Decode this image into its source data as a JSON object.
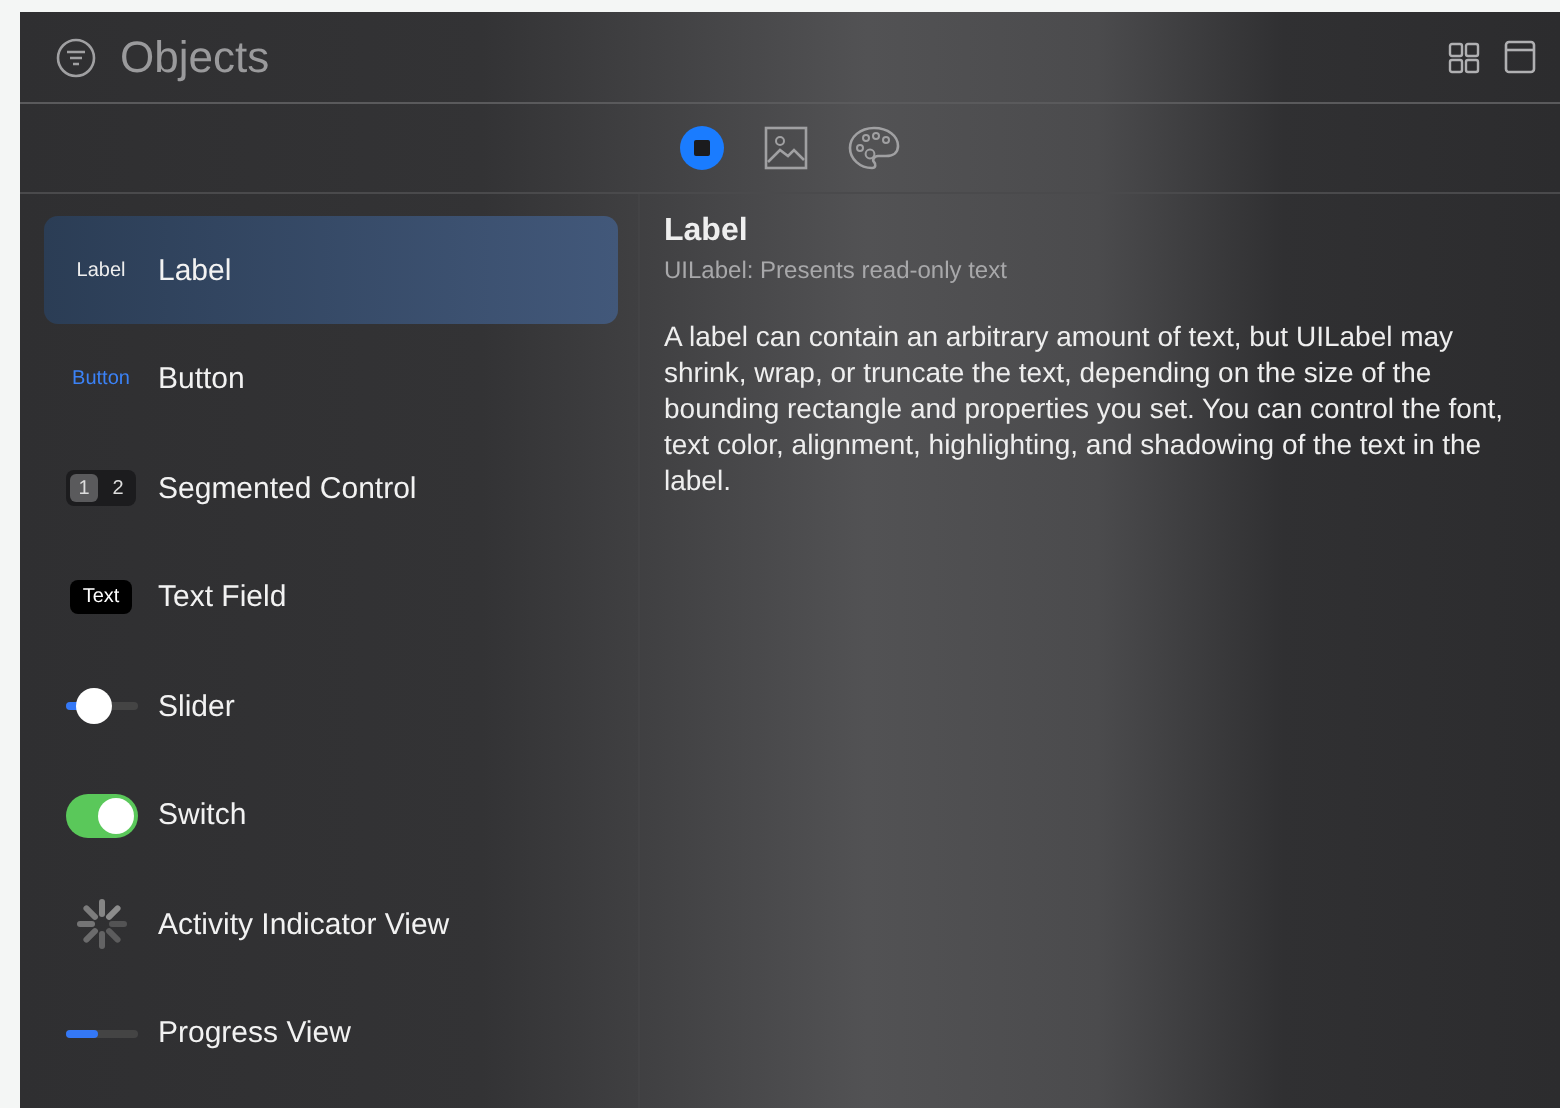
{
  "header": {
    "title": "Objects"
  },
  "tabs": [
    {
      "kind": "objects",
      "selected": true
    },
    {
      "kind": "media",
      "selected": false
    },
    {
      "kind": "colors",
      "selected": false
    }
  ],
  "items": [
    {
      "kind": "label",
      "name": "Label",
      "preview": "Label",
      "selected": true
    },
    {
      "kind": "button",
      "name": "Button",
      "preview": "Button",
      "selected": false
    },
    {
      "kind": "segmented",
      "name": "Segmented Control",
      "segments": [
        "1",
        "2"
      ],
      "selected": false
    },
    {
      "kind": "textfield",
      "name": "Text Field",
      "preview": "Text",
      "selected": false
    },
    {
      "kind": "slider",
      "name": "Slider",
      "level": 0.3,
      "selected": false
    },
    {
      "kind": "switch",
      "name": "Switch",
      "on": true,
      "selected": false
    },
    {
      "kind": "activity",
      "name": "Activity Indicator View",
      "selected": false
    },
    {
      "kind": "progress",
      "name": "Progress View",
      "level": 0.45,
      "selected": false
    }
  ],
  "detail": {
    "title": "Label",
    "subtitle": "UILabel: Presents read-only text",
    "description": "A label can contain an arbitrary amount of text, but UILabel may shrink, wrap, or truncate the text, depending on the size of the bounding rectangle and properties you set. You can control the font, text color, alignment, highlighting, and shadowing of the text in the label."
  }
}
